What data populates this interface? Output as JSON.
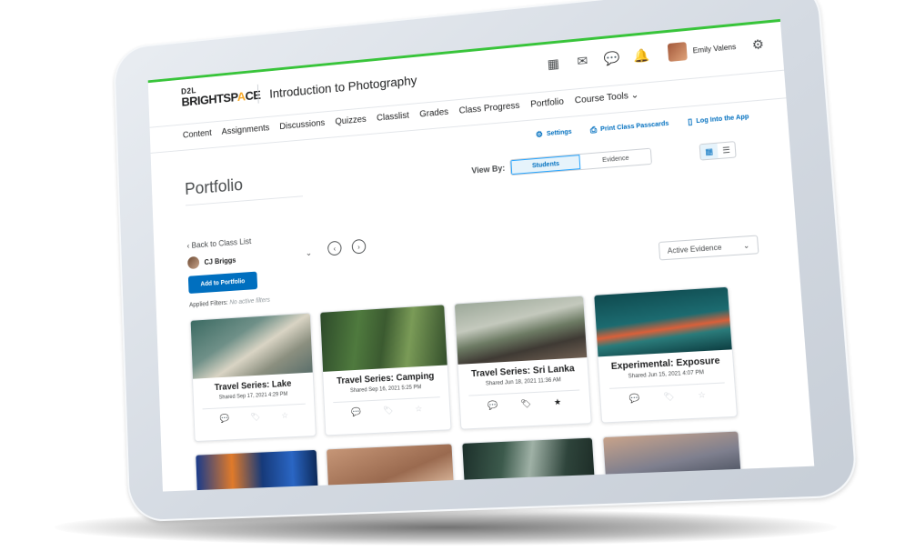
{
  "brand": {
    "line1": "D2L",
    "line2_a": "BRIGHTSP",
    "line2_o": "A",
    "line2_b": "CE"
  },
  "course": {
    "title": "Introduction to Photography"
  },
  "user": {
    "name": "Emily Valens"
  },
  "nav": [
    "Content",
    "Assignments",
    "Discussions",
    "Quizzes",
    "Classlist",
    "Grades",
    "Class Progress",
    "Portfolio",
    "Course Tools"
  ],
  "tools": {
    "settings": "Settings",
    "print": "Print Class Passcards",
    "app": "Log Into the App"
  },
  "page": {
    "title": "Portfolio"
  },
  "viewby": {
    "label": "View By:",
    "students": "Students",
    "evidence": "Evidence"
  },
  "back": "Back to Class List",
  "student": {
    "name": "CJ Briggs"
  },
  "add_button": "Add to Portfolio",
  "filters": {
    "label": "Applied Filters:",
    "value": "No active filters"
  },
  "evidence_select": "Active Evidence",
  "cards": [
    {
      "title": "Travel Series: Lake",
      "date": "Shared Sep 17, 2021 4:29 PM"
    },
    {
      "title": "Travel Series: Camping",
      "date": "Shared Sep 16, 2021 5:25 PM"
    },
    {
      "title": "Travel Series: Sri Lanka",
      "date": "Shared Jun 18, 2021 11:36 AM"
    },
    {
      "title": "Experimental: Exposure",
      "date": "Shared Jun 15, 2021 4:07 PM"
    }
  ]
}
